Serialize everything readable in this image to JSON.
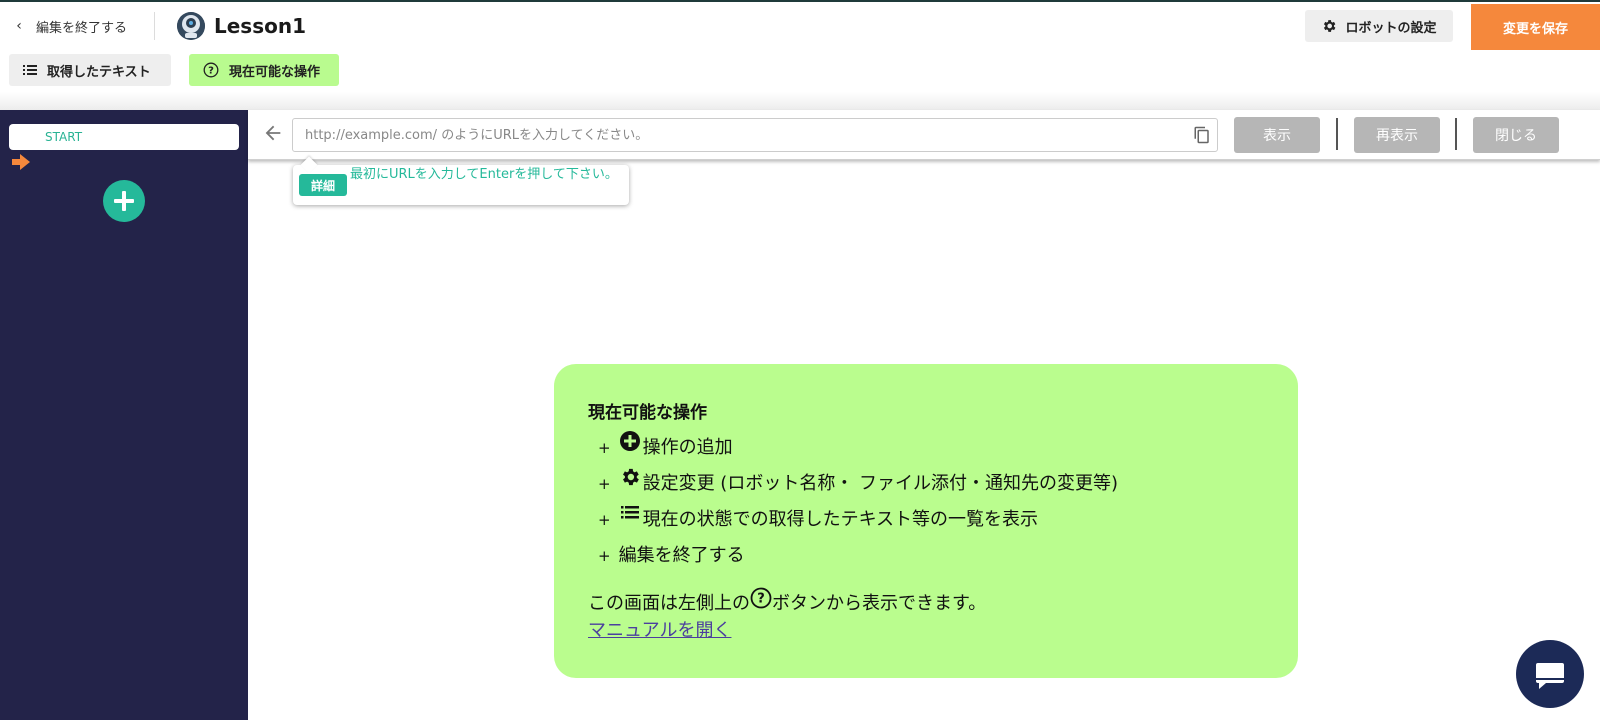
{
  "header": {
    "back_label": "編集を終了する",
    "title": "Lesson1",
    "settings_label": "ロボットの設定",
    "save_label": "変更を保存"
  },
  "toolbar": {
    "text_list_label": "取得したテキスト",
    "ops_label": "現在可能な操作"
  },
  "sidebar": {
    "start_label": "START"
  },
  "browser": {
    "url_placeholder": "http://example.com/ のようにURLを入力してください。",
    "url_value": "",
    "show_label": "表示",
    "reload_label": "再表示",
    "close_label": "閉じる"
  },
  "tooltip": {
    "badge": "詳細",
    "text": "最初にURLを入力してEnterを押して下さい。"
  },
  "help": {
    "title": "現在可能な操作",
    "items": [
      {
        "icon": "plus-circle-icon",
        "text": "操作の追加"
      },
      {
        "icon": "gear-icon",
        "text": "設定変更 (ロボット名称・ ファイル添付・通知先の変更等)"
      },
      {
        "icon": "list-icon",
        "text": "現在の状態での取得したテキスト等の一覧を表示"
      },
      {
        "icon": "",
        "text": "編集を終了する"
      }
    ],
    "footer_before": "この画面は左側上の",
    "footer_after": "ボタンから表示できます。",
    "manual_link": "マニュアルを開く"
  },
  "colors": {
    "accent_green": "#25b99a",
    "save_orange": "#f5883c",
    "panel_green": "#bafd8e",
    "sidebar_navy": "#232349"
  }
}
